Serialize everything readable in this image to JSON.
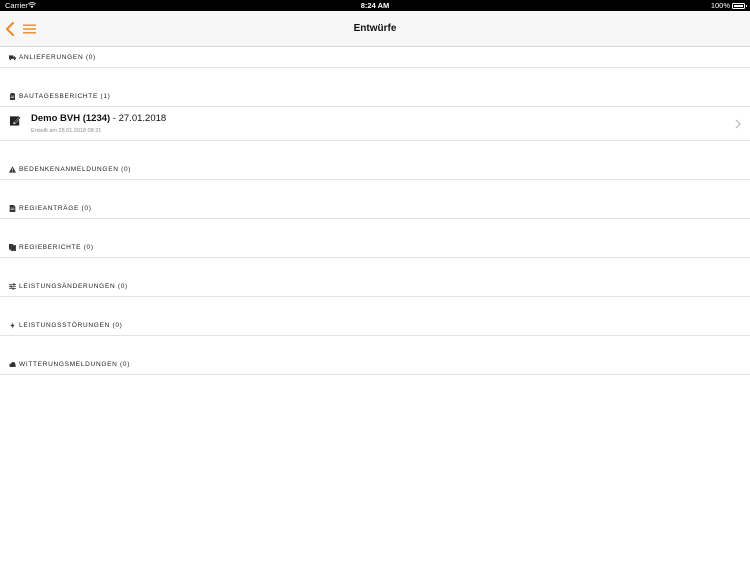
{
  "status_bar": {
    "carrier": "Carrier",
    "time": "8:24 AM",
    "battery": "100%"
  },
  "nav": {
    "title": "Entwürfe"
  },
  "colors": {
    "accent": "#e8892c"
  },
  "sections": [
    {
      "icon": "truck-icon",
      "label": "ANLIEFERUNGEN (0)"
    },
    {
      "icon": "clipboard-icon",
      "label": "BAUTAGESBERICHTE (1)"
    },
    {
      "icon": "warning-icon",
      "label": "BEDENKENANMELDUNGEN (0)"
    },
    {
      "icon": "document-icon",
      "label": "REGIEANTRÄGE (0)"
    },
    {
      "icon": "copy-icon",
      "label": "REGIEBERICHTE (0)"
    },
    {
      "icon": "sliders-icon",
      "label": "LEISTUNGSÄNDERUNGEN (0)"
    },
    {
      "icon": "bolt-icon",
      "label": "LEISTUNGSSTÖRUNGEN (0)"
    },
    {
      "icon": "cloud-icon",
      "label": "WITTERUNGSMELDUNGEN (0)"
    }
  ],
  "drafts": [
    {
      "title_bold": "Demo BVH (1234)",
      "title_rest": " - 27.01.2018",
      "subtitle": "Erstellt am 28.01.2018 08:21"
    }
  ]
}
